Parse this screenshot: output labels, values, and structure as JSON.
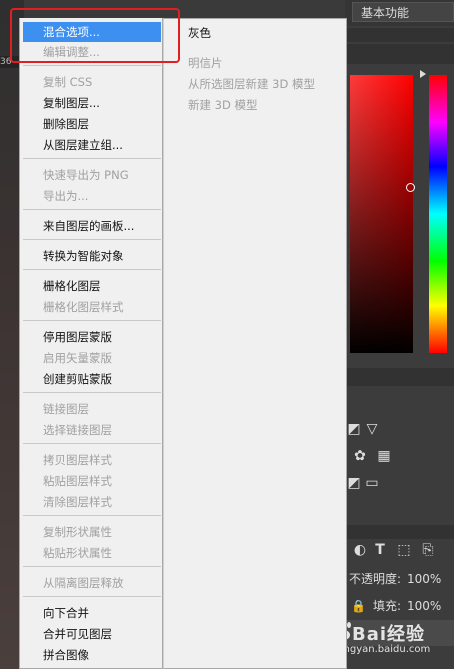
{
  "left_strip": {
    "label": "36"
  },
  "workspace": {
    "label": "基本功能"
  },
  "opacity": {
    "label": "不透明度:",
    "value": "100%"
  },
  "fill": {
    "label": "填充:",
    "value": "100%"
  },
  "watermark": {
    "main": "Bai经验",
    "sub": "jingyan.baidu.com"
  },
  "menu": {
    "items": [
      {
        "label": "混合选项...",
        "disabled": false,
        "highlight": true
      },
      {
        "label": "编辑调整...",
        "disabled": true
      },
      {
        "label": "复制 CSS",
        "disabled": true
      },
      {
        "label": "复制图层...",
        "disabled": false
      },
      {
        "label": "删除图层",
        "disabled": false
      },
      {
        "label": "从图层建立组...",
        "disabled": false
      },
      {
        "label": "快速导出为 PNG",
        "disabled": true
      },
      {
        "label": "导出为...",
        "disabled": true
      },
      {
        "label": "来自图层的画板...",
        "disabled": false
      },
      {
        "label": "转换为智能对象",
        "disabled": false
      },
      {
        "label": "栅格化图层",
        "disabled": false
      },
      {
        "label": "栅格化图层样式",
        "disabled": true
      },
      {
        "label": "停用图层蒙版",
        "disabled": false
      },
      {
        "label": "启用矢量蒙版",
        "disabled": true
      },
      {
        "label": "创建剪贴蒙版",
        "disabled": false
      },
      {
        "label": "链接图层",
        "disabled": true
      },
      {
        "label": "选择链接图层",
        "disabled": true
      },
      {
        "label": "拷贝图层样式",
        "disabled": true
      },
      {
        "label": "粘贴图层样式",
        "disabled": true
      },
      {
        "label": "清除图层样式",
        "disabled": true
      },
      {
        "label": "复制形状属性",
        "disabled": true
      },
      {
        "label": "粘贴形状属性",
        "disabled": true
      },
      {
        "label": "从隔离图层释放",
        "disabled": true
      },
      {
        "label": "向下合并",
        "disabled": false
      },
      {
        "label": "合并可见图层",
        "disabled": false
      },
      {
        "label": "拼合图像",
        "disabled": false
      }
    ]
  },
  "submenu": {
    "items": [
      {
        "label": "灰色",
        "disabled": false
      },
      {
        "label": "明信片",
        "disabled": true
      },
      {
        "label": "从所选图层新建 3D 模型",
        "disabled": true
      },
      {
        "label": "新建 3D 模型",
        "disabled": true
      }
    ]
  },
  "icons": [
    "triangle-icon",
    "circle-icon",
    "grid-icon",
    "text-icon",
    "transform-icon",
    "lock-icon"
  ]
}
